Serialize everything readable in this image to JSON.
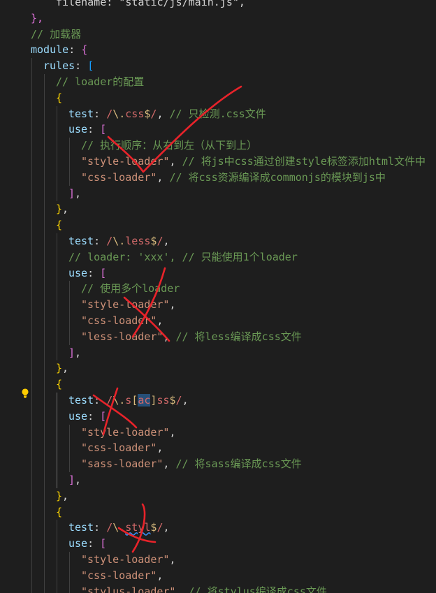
{
  "editor": {
    "lines": [
      [
        {
          "t": "filename: \"static/js/main.js\",",
          "c": "pun"
        }
      ],
      [
        {
          "t": "},",
          "c": "brk2"
        }
      ],
      [
        {
          "t": "// 加载器",
          "c": "com"
        }
      ],
      [
        {
          "t": "module",
          "c": "kw"
        },
        {
          "t": ": ",
          "c": "pun"
        },
        {
          "t": "{",
          "c": "brk2"
        }
      ],
      [
        {
          "t": "rules",
          "c": "kw"
        },
        {
          "t": ": ",
          "c": "pun"
        },
        {
          "t": "[",
          "c": "brk3"
        }
      ],
      [
        {
          "t": "// loader的配置",
          "c": "com"
        }
      ],
      [
        {
          "t": "{",
          "c": "brk"
        }
      ],
      [
        {
          "t": "test",
          "c": "kw"
        },
        {
          "t": ": ",
          "c": "pun"
        },
        {
          "t": "/",
          "c": "re"
        },
        {
          "t": "\\.",
          "c": "esc"
        },
        {
          "t": "css",
          "c": "re"
        },
        {
          "t": "$",
          "c": "esc"
        },
        {
          "t": "/",
          "c": "re"
        },
        {
          "t": ", ",
          "c": "pun"
        },
        {
          "t": "// 只检测.css文件",
          "c": "com"
        }
      ],
      [
        {
          "t": "use",
          "c": "kw"
        },
        {
          "t": ": ",
          "c": "pun"
        },
        {
          "t": "[",
          "c": "brk2"
        }
      ],
      [
        {
          "t": "// 执行顺序：从右到左（从下到上）",
          "c": "com"
        }
      ],
      [
        {
          "t": "\"style-loader\"",
          "c": "str"
        },
        {
          "t": ", ",
          "c": "pun"
        },
        {
          "t": "// 将js中css通过创建style标签添加html文件中",
          "c": "com"
        }
      ],
      [
        {
          "t": "\"css-loader\"",
          "c": "str"
        },
        {
          "t": ", ",
          "c": "pun"
        },
        {
          "t": "// 将css资源编译成commonjs的模块到js中",
          "c": "com"
        }
      ],
      [
        {
          "t": "]",
          "c": "brk2"
        },
        {
          "t": ",",
          "c": "pun"
        }
      ],
      [
        {
          "t": "}",
          "c": "brk"
        },
        {
          "t": ",",
          "c": "pun"
        }
      ],
      [
        {
          "t": "{",
          "c": "brk"
        }
      ],
      [
        {
          "t": "test",
          "c": "kw"
        },
        {
          "t": ": ",
          "c": "pun"
        },
        {
          "t": "/",
          "c": "re"
        },
        {
          "t": "\\.",
          "c": "esc"
        },
        {
          "t": "less",
          "c": "re"
        },
        {
          "t": "$",
          "c": "esc"
        },
        {
          "t": "/",
          "c": "re"
        },
        {
          "t": ",",
          "c": "pun"
        }
      ],
      [
        {
          "t": "// loader: 'xxx', // 只能使用1个loader",
          "c": "com"
        }
      ],
      [
        {
          "t": "use",
          "c": "kw"
        },
        {
          "t": ": ",
          "c": "pun"
        },
        {
          "t": "[",
          "c": "brk2"
        }
      ],
      [
        {
          "t": "// 使用多个loader",
          "c": "com"
        }
      ],
      [
        {
          "t": "\"style-loader\"",
          "c": "str"
        },
        {
          "t": ",",
          "c": "pun"
        }
      ],
      [
        {
          "t": "\"css-loader\"",
          "c": "str"
        },
        {
          "t": ",",
          "c": "pun"
        }
      ],
      [
        {
          "t": "\"less-loader\"",
          "c": "str"
        },
        {
          "t": ", ",
          "c": "pun"
        },
        {
          "t": "// 将less编译成css文件",
          "c": "com"
        }
      ],
      [
        {
          "t": "]",
          "c": "brk2"
        },
        {
          "t": ",",
          "c": "pun"
        }
      ],
      [
        {
          "t": "}",
          "c": "brk"
        },
        {
          "t": ",",
          "c": "pun"
        }
      ],
      [
        {
          "t": "{",
          "c": "brk"
        }
      ],
      [
        {
          "t": "test",
          "c": "kw"
        },
        {
          "t": ": ",
          "c": "pun"
        },
        {
          "t": "/",
          "c": "re"
        },
        {
          "t": "\\.",
          "c": "esc"
        },
        {
          "t": "s",
          "c": "re"
        },
        {
          "t": "[",
          "c": "esc"
        },
        {
          "t": "ac",
          "c": "re",
          "sel": true
        },
        {
          "t": "]",
          "c": "esc"
        },
        {
          "t": "ss",
          "c": "re"
        },
        {
          "t": "$",
          "c": "esc"
        },
        {
          "t": "/",
          "c": "re"
        },
        {
          "t": ",",
          "c": "pun"
        }
      ],
      [
        {
          "t": "use",
          "c": "kw"
        },
        {
          "t": ": ",
          "c": "pun"
        },
        {
          "t": "[",
          "c": "brk2"
        }
      ],
      [
        {
          "t": "\"style-loader\"",
          "c": "str"
        },
        {
          "t": ",",
          "c": "pun"
        }
      ],
      [
        {
          "t": "\"css-loader\"",
          "c": "str"
        },
        {
          "t": ",",
          "c": "pun"
        }
      ],
      [
        {
          "t": "\"sass-loader\"",
          "c": "str"
        },
        {
          "t": ", ",
          "c": "pun"
        },
        {
          "t": "// 将sass编译成css文件",
          "c": "com"
        }
      ],
      [
        {
          "t": "]",
          "c": "brk2"
        },
        {
          "t": ",",
          "c": "pun"
        }
      ],
      [
        {
          "t": "}",
          "c": "brk"
        },
        {
          "t": ",",
          "c": "pun"
        }
      ],
      [
        {
          "t": "{",
          "c": "brk"
        }
      ],
      [
        {
          "t": "test",
          "c": "kw"
        },
        {
          "t": ": ",
          "c": "pun"
        },
        {
          "t": "/",
          "c": "re"
        },
        {
          "t": "\\.",
          "c": "esc"
        },
        {
          "t": "styl",
          "c": "re",
          "squig": true
        },
        {
          "t": "$",
          "c": "esc"
        },
        {
          "t": "/",
          "c": "re"
        },
        {
          "t": ",",
          "c": "pun"
        }
      ],
      [
        {
          "t": "use",
          "c": "kw"
        },
        {
          "t": ": ",
          "c": "pun"
        },
        {
          "t": "[",
          "c": "brk2"
        }
      ],
      [
        {
          "t": "\"style-loader\"",
          "c": "str"
        },
        {
          "t": ",",
          "c": "pun"
        }
      ],
      [
        {
          "t": "\"css-loader\"",
          "c": "str"
        },
        {
          "t": ",",
          "c": "pun"
        }
      ],
      [
        {
          "t": "\"stylus-loader\"",
          "c": "str"
        },
        {
          "t": ", ",
          "c": "pun"
        },
        {
          "t": "// 将stylus编译成css文件",
          "c": "com"
        }
      ]
    ],
    "colors": {
      "background": "#1e1e1e",
      "annotation_red": "#e8232a",
      "lightbulb": "#ffcc00"
    },
    "lightbulb_icon": "lightbulb-icon"
  }
}
